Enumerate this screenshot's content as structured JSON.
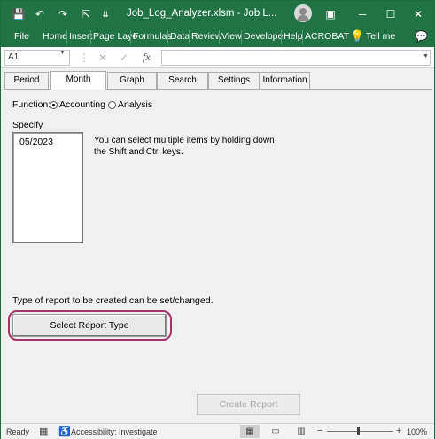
{
  "window": {
    "title": "Job_Log_Analyzer.xlsm  -  Job L...",
    "save_icon": "💾",
    "undo_icon": "↶",
    "redo_icon": "↷",
    "pointer_icon": "⇱",
    "qat_more_icon": "⇊",
    "ribbon_display_icon": "▣",
    "minimize_icon": "─",
    "maximize_icon": "☐",
    "close_icon": "✕"
  },
  "ribbon": {
    "tabs": [
      "File",
      "Home",
      "Insert",
      "Page Layo",
      "Formulas",
      "Data",
      "Review",
      "View",
      "Developer",
      "Help",
      "ACROBAT"
    ],
    "tell_me": "Tell me",
    "tell_me_icon": "💡",
    "comments_icon": "💬"
  },
  "formula_bar": {
    "name_box": "A1",
    "name_box_arrow": "▼",
    "more_icon": "⋮",
    "cancel_icon": "✕",
    "enter_icon": "✓",
    "fx_label": "fx",
    "formula_value": "",
    "expand_icon": "▼"
  },
  "form": {
    "tabs": [
      "Period",
      "Month",
      "Graph",
      "Search",
      "Settings",
      "Information"
    ],
    "active_tab": "Month",
    "function_label": "Function:",
    "function_options": [
      "Accounting",
      "Analysis"
    ],
    "function_selected": "Accounting",
    "specify_label": "Specify",
    "months": [
      "05/2023"
    ],
    "hint": "You can select multiple items by holding down the Shift and Ctrl keys.",
    "report_type_label": "Type of report to be created can be set/changed.",
    "select_report_type_button": "Select Report Type",
    "create_report_button": "Create Report",
    "create_report_enabled": false
  },
  "status_bar": {
    "ready": "Ready",
    "macro_icon": "▦",
    "accessibility_icon": "♿",
    "accessibility": "Accessibility: Investigate",
    "view_normal_icon": "▦",
    "view_page_layout_icon": "▭",
    "view_page_break_icon": "▥",
    "zoom_minus": "−",
    "zoom_plus": "+",
    "zoom": "100%"
  },
  "colors": {
    "excel_green": "#217346",
    "highlight_ring": "#a9326a"
  }
}
